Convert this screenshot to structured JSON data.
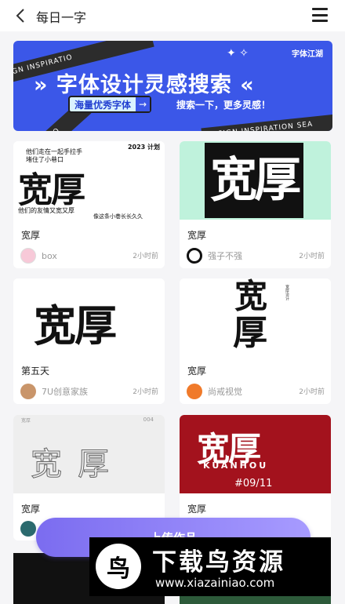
{
  "header": {
    "title": "每日一字"
  },
  "banner": {
    "brand": "字体江湖",
    "headline": "» 字体设计灵感搜索 «",
    "tag_text": "海量优秀字体",
    "tag_arrow": "→",
    "sub": "搜索一下，更多灵感！",
    "band_text": "DESIGN INSPIRATION SEA",
    "band_text_short": "SIGN INSPIRATIO"
  },
  "cards": [
    {
      "title": "宽厚",
      "author": "box",
      "time": "2小时前",
      "thumb": {
        "main": "宽厚",
        "line1": "他们走在一起手拉手",
        "line2": "堵住了小巷口",
        "line3": "他们的友情又宽又厚",
        "line4": "像这条小巷长长久久",
        "corner": "2023 计划"
      }
    },
    {
      "title": "宽厚",
      "author": "强子不强",
      "time": "2小时前",
      "thumb": {
        "main": "宽厚"
      }
    },
    {
      "title": "第五天",
      "author": "7U创意家族",
      "time": "2小时前",
      "thumb": {
        "main": "宽厚"
      }
    },
    {
      "title": "宽厚",
      "author": "尚戒视觉",
      "time": "2小时前",
      "thumb": {
        "main1": "宽",
        "main2": "厚",
        "side": "宽厚设计"
      }
    },
    {
      "title": "宽厚",
      "author": "",
      "time": "",
      "thumb": {
        "main": "宽厚",
        "num": "004",
        "small_left": "宽厚"
      }
    },
    {
      "title": "宽厚",
      "author": "",
      "time": "",
      "thumb": {
        "main": "宽厚",
        "roman": "KUANHOU",
        "num": "#09/11"
      }
    }
  ],
  "fab": {
    "label": "上传作品"
  },
  "watermark": {
    "logo_char": "鸟",
    "name": "下载鸟资源",
    "url": "www.xiazainiao.com"
  },
  "colors": {
    "accent": "#7b6cf0",
    "banner_blue": "#3b57e8",
    "red_thumb": "#a3121d",
    "mint_thumb": "#bff2dc"
  }
}
